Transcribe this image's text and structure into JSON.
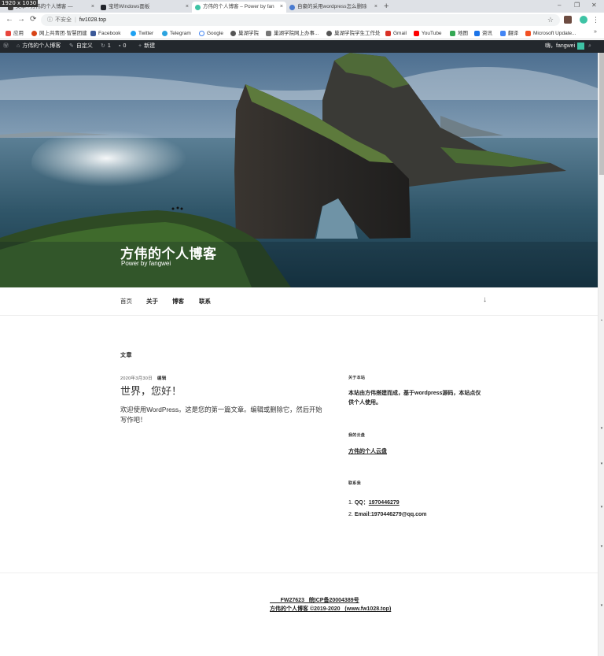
{
  "screen": {
    "resolution_badge": "1920 x 1030"
  },
  "browser": {
    "tabs": [
      {
        "title": "文章 ‹ 方伟的个人博客 —",
        "active": false,
        "favicon_color": "#464646"
      },
      {
        "title": "宝塔Windows面板",
        "active": false,
        "favicon_color": "#20232a"
      },
      {
        "title": "方伟的个人博客 – Power by fan",
        "active": true,
        "favicon_color": "#3ec3a5"
      },
      {
        "title": "自豪的采用wordpress怎么删除",
        "active": false,
        "favicon_color": "#4a7bd0"
      }
    ],
    "tab_close_glyph": "×",
    "new_tab_glyph": "+",
    "window_controls": [
      "–",
      "❐",
      "✕"
    ],
    "omnibox": {
      "security_label": "不安全",
      "url": "fw1028.top",
      "lock_icon": "info-circle-icon",
      "star_icon": "star-outline-icon"
    },
    "nav_glyphs": {
      "back": "←",
      "forward": "→",
      "reload": "⟳"
    },
    "extensions": [
      {
        "name": "extension-icon",
        "color": "#6d4c41"
      },
      {
        "name": "profile-avatar-icon",
        "color": "#3ec3a5"
      }
    ],
    "menu_glyph": "⋮",
    "bookmarks": [
      {
        "label": "应用",
        "color": "#e8453c"
      },
      {
        "label": "网上共青团·智慧团建",
        "color": "#d84315"
      },
      {
        "label": "Facebook",
        "color": "#3b5998"
      },
      {
        "label": "Twitter",
        "color": "#1da1f2"
      },
      {
        "label": "Telegram",
        "color": "#2aa3df"
      },
      {
        "label": "Google",
        "color": "#ffffff"
      },
      {
        "label": "巢湖学院",
        "color": "#555555"
      },
      {
        "label": "巢湖学院网上办事...",
        "color": "#777777"
      },
      {
        "label": "巢湖学院学生工作处",
        "color": "#555555"
      },
      {
        "label": "Gmail",
        "color": "#d93025"
      },
      {
        "label": "YouTube",
        "color": "#ff0000"
      },
      {
        "label": "地图",
        "color": "#34a853"
      },
      {
        "label": "资讯",
        "color": "#1a73e8"
      },
      {
        "label": "翻译",
        "color": "#4285f4"
      },
      {
        "label": "Microsoft Update...",
        "color": "#f25022"
      }
    ],
    "bookmarks_more": "»"
  },
  "admin_bar": {
    "wp_logo_icon": "wordpress-logo-icon",
    "site_name": "方伟的个人博客",
    "customize": "自定义",
    "updates_count": "1",
    "comments_count": "0",
    "new_label": "新建",
    "greeting": "嗨，fangwei",
    "search_icon": "search-icon"
  },
  "header": {
    "site_title": "方伟的个人博客",
    "tagline": "Power by fangwei"
  },
  "nav": {
    "items": [
      "首页",
      "关于",
      "博客",
      "联系"
    ],
    "scroll_down_glyph": "↓"
  },
  "main": {
    "section_title": "文章",
    "post": {
      "date": "2020年3月30日",
      "edit_label": "编辑",
      "title": "世界，您好！",
      "excerpt": "欢迎使用WordPress。这是您的第一篇文章。编辑或删除它，然后开始写作吧！"
    }
  },
  "sidebar": {
    "about": {
      "title": "关于本站",
      "text": "本站由方伟搭建而成，基于wordpress源码，本站点仅供个人使用。"
    },
    "cloud": {
      "title": "我的云盘",
      "link": "方伟的个人云盘"
    },
    "contact": {
      "title": "联系我",
      "items": [
        {
          "num": "1.",
          "label": "QQ：",
          "value": "1970446279"
        },
        {
          "num": "2.",
          "label": "Email:",
          "value": "1970446279@qq.com"
        }
      ]
    }
  },
  "footer": {
    "line1": "       FW27623   皖ICP备20004389号",
    "line2": "方伟的个人博客 ©2019-2020   (www.fw1028.top)"
  }
}
